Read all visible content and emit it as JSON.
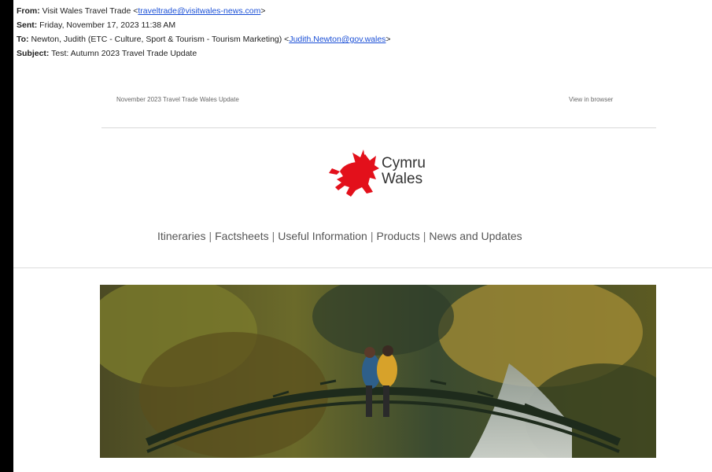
{
  "email": {
    "from_label": "From:",
    "from_name": "Visit Wales Travel Trade <",
    "from_address": "traveltrade@visitwales-news.com",
    "from_end": ">",
    "sent_label": "Sent:",
    "sent_value": "Friday, November 17, 2023 11:38 AM",
    "to_label": "To:",
    "to_name": "Newton, Judith (ETC - Culture, Sport & Tourism - Tourism Marketing) <",
    "to_address": "Judith.Newton@gov.wales",
    "to_end": ">",
    "subject_label": "Subject:",
    "subject_value": "Test: Autumn 2023 Travel Trade Update"
  },
  "newsletter": {
    "preheader": "November 2023 Travel Trade Wales Update",
    "view_in_browser": "View in browser",
    "logo_line1": "Cymru",
    "logo_line2": "Wales",
    "nav": [
      "Itineraries",
      "Factsheets",
      "Useful Information",
      "Products",
      "News and Updates"
    ],
    "nav_separator": "|"
  },
  "colors": {
    "link": "#1a4fd6",
    "dragon": "#e3101b"
  },
  "icons": {
    "logo": "welsh-dragon-icon"
  }
}
